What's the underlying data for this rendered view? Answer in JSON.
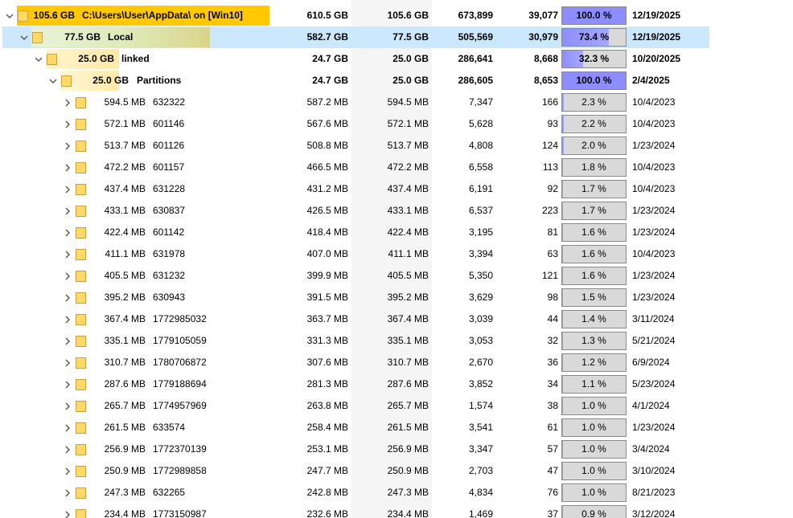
{
  "colors": {
    "selection": "#cce8ff",
    "root_bar": "#ffc800",
    "folder_fill": "#ffd966",
    "percent_fill": "#8d8dff",
    "percent_track": "#d9d9d9",
    "shaded_column": "#f5f5f5"
  },
  "rows": [
    {
      "level": 0,
      "expanded": true,
      "selected": false,
      "bold": true,
      "size_label": "105.6 GB",
      "name": "C:\\Users\\User\\AppData\\  on  [Win10]",
      "size_fraction": 1.0,
      "allocated": "610.5 GB",
      "size": "105.6 GB",
      "files": "673,899",
      "folders": "39,077",
      "percent": "100.0 %",
      "percent_value": 1.0,
      "modified": "12/19/2025"
    },
    {
      "level": 1,
      "expanded": true,
      "selected": true,
      "bold": true,
      "size_label": "77.5 GB",
      "name": "Local",
      "size_fraction": 0.734,
      "allocated": "582.7 GB",
      "size": "77.5 GB",
      "files": "505,569",
      "folders": "30,979",
      "percent": "73.4 %",
      "percent_value": 0.734,
      "modified": "12/19/2025"
    },
    {
      "level": 2,
      "expanded": true,
      "selected": false,
      "bold": true,
      "size_label": "25.0 GB",
      "name": "linked",
      "size_fraction": 0.323,
      "allocated": "24.7 GB",
      "size": "25.0 GB",
      "files": "286,641",
      "folders": "8,668",
      "percent": "32.3 %",
      "percent_value": 0.323,
      "modified": "10/20/2025"
    },
    {
      "level": 3,
      "expanded": true,
      "selected": false,
      "bold": true,
      "size_label": "25.0 GB",
      "name": "Partitions",
      "size_fraction": 1.0,
      "allocated": "24.7 GB",
      "size": "25.0 GB",
      "files": "286,605",
      "folders": "8,653",
      "percent": "100.0 %",
      "percent_value": 1.0,
      "modified": "2/4/2025"
    },
    {
      "level": 4,
      "expanded": false,
      "selected": false,
      "bold": false,
      "size_label": "594.5 MB",
      "name": "632322",
      "allocated": "587.2 MB",
      "size": "594.5 MB",
      "files": "7,347",
      "folders": "166",
      "percent": "2.3 %",
      "percent_value": 0.023,
      "modified": "10/4/2023"
    },
    {
      "level": 4,
      "expanded": false,
      "selected": false,
      "bold": false,
      "size_label": "572.1 MB",
      "name": "601146",
      "allocated": "567.6 MB",
      "size": "572.1 MB",
      "files": "5,628",
      "folders": "93",
      "percent": "2.2 %",
      "percent_value": 0.022,
      "modified": "10/4/2023"
    },
    {
      "level": 4,
      "expanded": false,
      "selected": false,
      "bold": false,
      "size_label": "513.7 MB",
      "name": "601126",
      "allocated": "508.8 MB",
      "size": "513.7 MB",
      "files": "4,808",
      "folders": "124",
      "percent": "2.0 %",
      "percent_value": 0.02,
      "modified": "1/23/2024"
    },
    {
      "level": 4,
      "expanded": false,
      "selected": false,
      "bold": false,
      "size_label": "472.2 MB",
      "name": "601157",
      "allocated": "466.5 MB",
      "size": "472.2 MB",
      "files": "6,558",
      "folders": "113",
      "percent": "1.8 %",
      "percent_value": 0.018,
      "modified": "10/4/2023"
    },
    {
      "level": 4,
      "expanded": false,
      "selected": false,
      "bold": false,
      "size_label": "437.4 MB",
      "name": "631228",
      "allocated": "431.2 MB",
      "size": "437.4 MB",
      "files": "6,191",
      "folders": "92",
      "percent": "1.7 %",
      "percent_value": 0.017,
      "modified": "10/4/2023"
    },
    {
      "level": 4,
      "expanded": false,
      "selected": false,
      "bold": false,
      "size_label": "433.1 MB",
      "name": "630837",
      "allocated": "426.5 MB",
      "size": "433.1 MB",
      "files": "6,537",
      "folders": "223",
      "percent": "1.7 %",
      "percent_value": 0.017,
      "modified": "1/23/2024"
    },
    {
      "level": 4,
      "expanded": false,
      "selected": false,
      "bold": false,
      "size_label": "422.4 MB",
      "name": "601142",
      "allocated": "418.4 MB",
      "size": "422.4 MB",
      "files": "3,195",
      "folders": "81",
      "percent": "1.6 %",
      "percent_value": 0.016,
      "modified": "1/23/2024"
    },
    {
      "level": 4,
      "expanded": false,
      "selected": false,
      "bold": false,
      "size_label": "411.1 MB",
      "name": "631978",
      "allocated": "407.0 MB",
      "size": "411.1 MB",
      "files": "3,394",
      "folders": "63",
      "percent": "1.6 %",
      "percent_value": 0.016,
      "modified": "10/4/2023"
    },
    {
      "level": 4,
      "expanded": false,
      "selected": false,
      "bold": false,
      "size_label": "405.5 MB",
      "name": "631232",
      "allocated": "399.9 MB",
      "size": "405.5 MB",
      "files": "5,350",
      "folders": "121",
      "percent": "1.6 %",
      "percent_value": 0.016,
      "modified": "1/23/2024"
    },
    {
      "level": 4,
      "expanded": false,
      "selected": false,
      "bold": false,
      "size_label": "395.2 MB",
      "name": "630943",
      "allocated": "391.5 MB",
      "size": "395.2 MB",
      "files": "3,629",
      "folders": "98",
      "percent": "1.5 %",
      "percent_value": 0.015,
      "modified": "1/23/2024"
    },
    {
      "level": 4,
      "expanded": false,
      "selected": false,
      "bold": false,
      "size_label": "367.4 MB",
      "name": "1772985032",
      "allocated": "363.7 MB",
      "size": "367.4 MB",
      "files": "3,039",
      "folders": "44",
      "percent": "1.4 %",
      "percent_value": 0.014,
      "modified": "3/11/2024"
    },
    {
      "level": 4,
      "expanded": false,
      "selected": false,
      "bold": false,
      "size_label": "335.1 MB",
      "name": "1779105059",
      "allocated": "331.3 MB",
      "size": "335.1 MB",
      "files": "3,053",
      "folders": "32",
      "percent": "1.3 %",
      "percent_value": 0.013,
      "modified": "5/21/2024"
    },
    {
      "level": 4,
      "expanded": false,
      "selected": false,
      "bold": false,
      "size_label": "310.7 MB",
      "name": "1780706872",
      "allocated": "307.6 MB",
      "size": "310.7 MB",
      "files": "2,670",
      "folders": "36",
      "percent": "1.2 %",
      "percent_value": 0.012,
      "modified": "6/9/2024"
    },
    {
      "level": 4,
      "expanded": false,
      "selected": false,
      "bold": false,
      "size_label": "287.6 MB",
      "name": "1779188694",
      "allocated": "281.3 MB",
      "size": "287.6 MB",
      "files": "3,852",
      "folders": "34",
      "percent": "1.1 %",
      "percent_value": 0.011,
      "modified": "5/23/2024"
    },
    {
      "level": 4,
      "expanded": false,
      "selected": false,
      "bold": false,
      "size_label": "265.7 MB",
      "name": "1774957969",
      "allocated": "263.8 MB",
      "size": "265.7 MB",
      "files": "1,574",
      "folders": "38",
      "percent": "1.0 %",
      "percent_value": 0.01,
      "modified": "4/1/2024"
    },
    {
      "level": 4,
      "expanded": false,
      "selected": false,
      "bold": false,
      "size_label": "261.5 MB",
      "name": "633574",
      "allocated": "258.4 MB",
      "size": "261.5 MB",
      "files": "3,541",
      "folders": "61",
      "percent": "1.0 %",
      "percent_value": 0.01,
      "modified": "1/23/2024"
    },
    {
      "level": 4,
      "expanded": false,
      "selected": false,
      "bold": false,
      "size_label": "256.9 MB",
      "name": "1772370139",
      "allocated": "253.1 MB",
      "size": "256.9 MB",
      "files": "3,347",
      "folders": "57",
      "percent": "1.0 %",
      "percent_value": 0.01,
      "modified": "3/4/2024"
    },
    {
      "level": 4,
      "expanded": false,
      "selected": false,
      "bold": false,
      "size_label": "250.9 MB",
      "name": "1772989858",
      "allocated": "247.7 MB",
      "size": "250.9 MB",
      "files": "2,703",
      "folders": "47",
      "percent": "1.0 %",
      "percent_value": 0.01,
      "modified": "3/10/2024"
    },
    {
      "level": 4,
      "expanded": false,
      "selected": false,
      "bold": false,
      "size_label": "247.3 MB",
      "name": "632265",
      "allocated": "242.8 MB",
      "size": "247.3 MB",
      "files": "4,834",
      "folders": "76",
      "percent": "1.0 %",
      "percent_value": 0.01,
      "modified": "8/21/2023"
    },
    {
      "level": 4,
      "expanded": false,
      "selected": false,
      "bold": false,
      "size_label": "234.4 MB",
      "name": "1773150987",
      "allocated": "232.6 MB",
      "size": "234.4 MB",
      "files": "1,469",
      "folders": "37",
      "percent": "0.9 %",
      "percent_value": 0.009,
      "modified": "3/12/2024"
    }
  ]
}
